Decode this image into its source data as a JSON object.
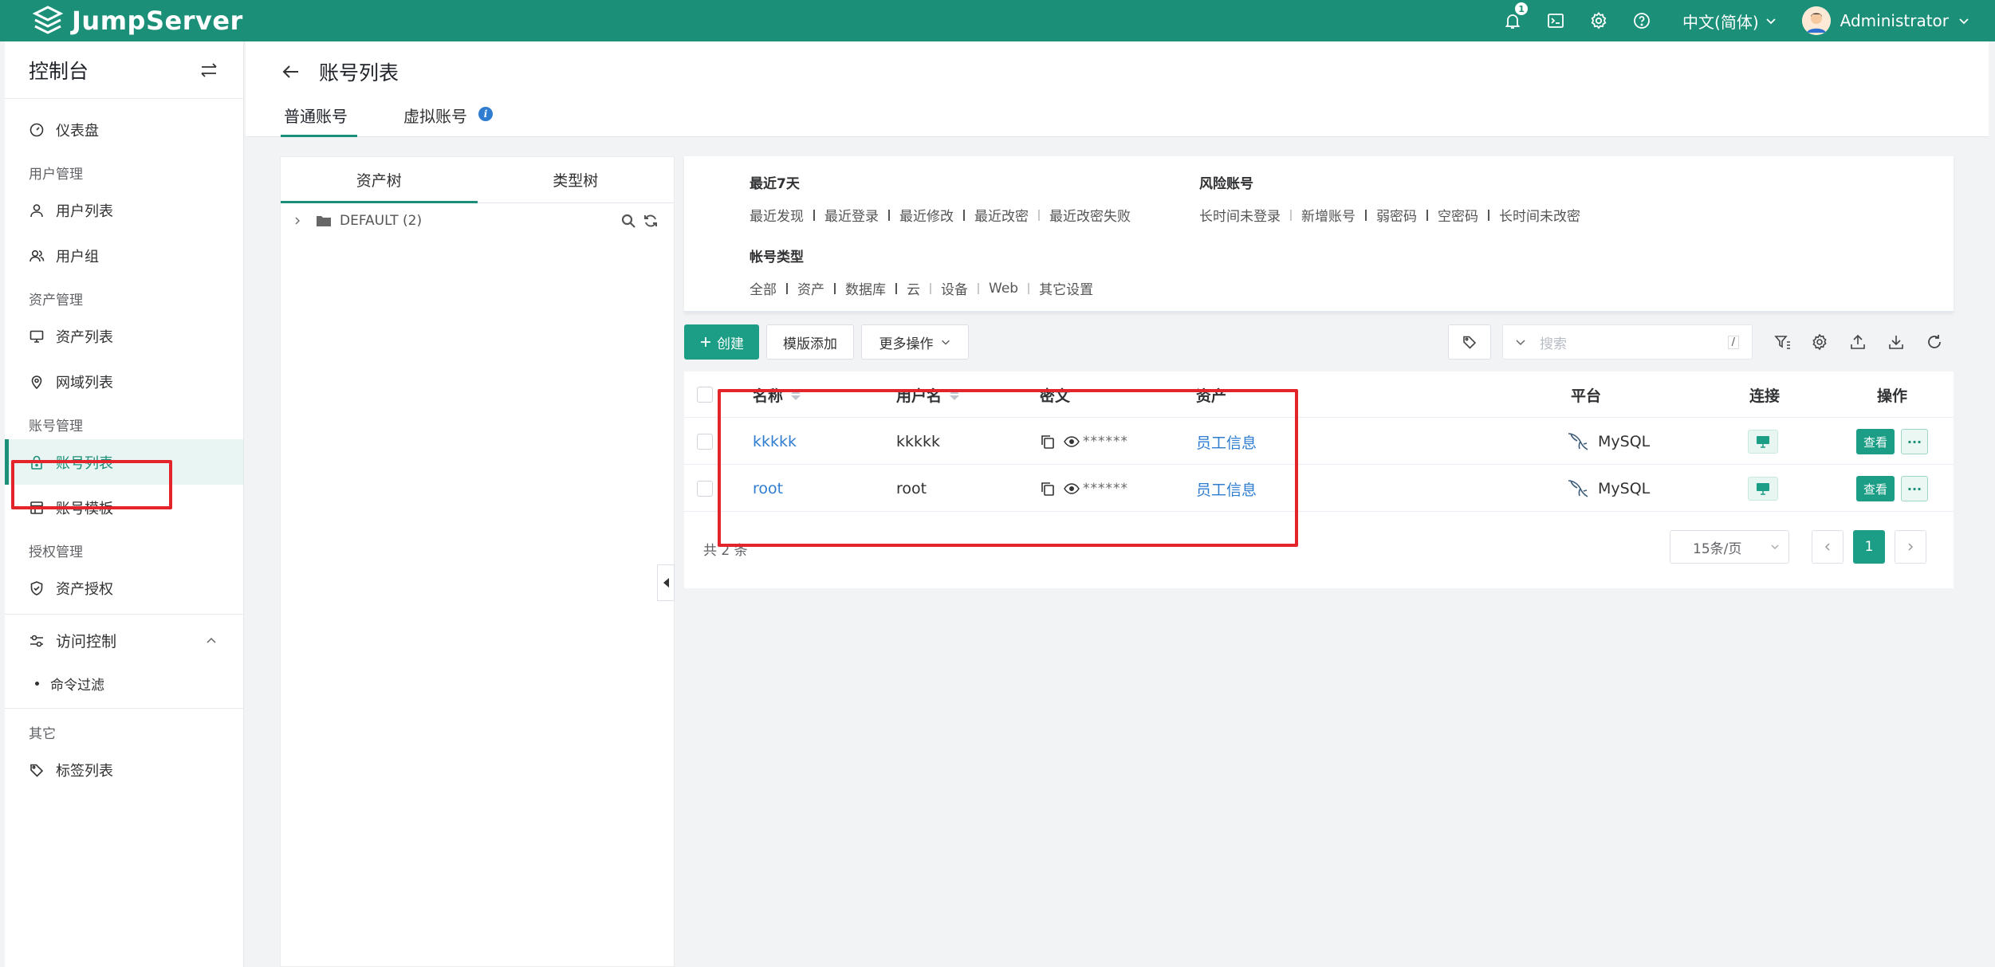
{
  "topbar": {
    "brand": "JumpServer",
    "notification_count": "1",
    "language": "中文(简体)",
    "username": "Administrator",
    "bg_color": "#1b8f78"
  },
  "sidebar": {
    "title": "控制台",
    "dashboard": "仪表盘",
    "groups": {
      "users": "用户管理",
      "assets": "资产管理",
      "accounts": "账号管理",
      "perms": "授权管理",
      "other": "其它"
    },
    "items": {
      "user_list": "用户列表",
      "user_group": "用户组",
      "asset_list": "资产列表",
      "zone_list": "网域列表",
      "account_list": "账号列表",
      "account_template": "账号模板",
      "asset_perm": "资产授权",
      "access_control": "访问控制",
      "cmd_filter": "命令过滤",
      "label_list": "标签列表"
    }
  },
  "page": {
    "title": "账号列表",
    "tabs": [
      "普通账号",
      "虚拟账号"
    ]
  },
  "tree": {
    "tabs": [
      "资产树",
      "类型树"
    ],
    "root_node": "DEFAULT (2)"
  },
  "filters": {
    "recent": {
      "title": "最近7天",
      "items": [
        "最近发现",
        "最近登录",
        "最近修改",
        "最近改密",
        "最近改密失败"
      ]
    },
    "risk": {
      "title": "风险账号",
      "items": [
        "长时间未登录",
        "新增账号",
        "弱密码",
        "空密码",
        "长时间未改密"
      ]
    },
    "type": {
      "title": "帐号类型",
      "items": [
        "全部",
        "资产",
        "数据库",
        "云",
        "设备",
        "Web",
        "其它设置"
      ]
    }
  },
  "toolbar": {
    "create": "创建",
    "template_add": "模版添加",
    "more_actions": "更多操作",
    "search_placeholder": "搜索",
    "search_shortcut": "/"
  },
  "table": {
    "columns": [
      "名称",
      "用户名",
      "密文",
      "资产",
      "平台",
      "连接",
      "操作"
    ],
    "rows": [
      {
        "name": "kkkkk",
        "username": "kkkkk",
        "secret": "******",
        "asset": "员工信息",
        "platform": "MySQL",
        "view": "查看",
        "more": "···"
      },
      {
        "name": "root",
        "username": "root",
        "secret": "******",
        "asset": "员工信息",
        "platform": "MySQL",
        "view": "查看",
        "more": "···"
      }
    ],
    "total": "共 2 条",
    "page_size": "15条/页",
    "current_page": "1"
  }
}
